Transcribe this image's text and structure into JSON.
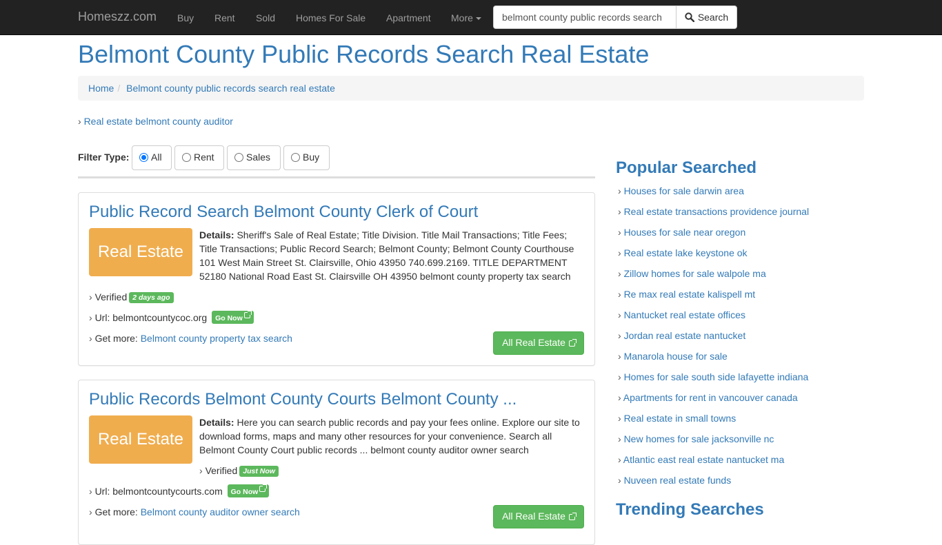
{
  "navbar": {
    "brand": "Homeszz.com",
    "items": [
      "Buy",
      "Rent",
      "Sold",
      "Homes For Sale",
      "Apartment",
      "More"
    ],
    "search_value": "belmont county public records search",
    "search_button": "Search"
  },
  "header": {
    "title": "Belmont County Public Records Search Real Estate",
    "breadcrumb": [
      "Home",
      "Belmont county public records search real estate"
    ],
    "related_link": "Real estate belmont county auditor"
  },
  "filter": {
    "label": "Filter Type:",
    "options": [
      "All",
      "Rent",
      "Sales",
      "Buy"
    ],
    "selected": "All"
  },
  "results": [
    {
      "title": "Public Record Search Belmont County Clerk of Court",
      "thumb": "Real Estate",
      "details_label": "Details:",
      "details": "Sheriff's Sale of Real Estate; Title Division. Title Mail Transactions; Title Fees; Title Transactions; Public Record Search; Belmont County; Belmont County Courthouse 101 West Main Street St. Clairsville, Ohio 43950 740.699.2169. TITLE DEPARTMENT 52180 National Road East St. Clairsville OH 43950 belmont county property tax search",
      "verified_label": "Verified",
      "verified_badge": "2 days ago",
      "url_label": "Url: belmontcountycoc.org",
      "go_now": "Go Now",
      "get_more_label": "Get more:",
      "get_more_link": "Belmont county property tax search",
      "button": "All Real Estate"
    },
    {
      "title": "Public Records Belmont County Courts Belmont County ...",
      "thumb": "Real Estate",
      "details_label": "Details:",
      "details": "Here you can search public records and pay your fees online. Explore our site to download forms, maps and many other resources for your convenience. Search all Belmont County Court public records ... belmont county auditor owner search",
      "verified_label": "Verified",
      "verified_badge": "Just Now",
      "url_label": "Url: belmontcountycourts.com",
      "go_now": "Go Now",
      "get_more_label": "Get more:",
      "get_more_link": "Belmont county auditor owner search",
      "button": "All Real Estate"
    }
  ],
  "sidebar": {
    "popular_title": "Popular Searched",
    "popular": [
      "Houses for sale darwin area",
      "Real estate transactions providence journal",
      "Houses for sale near oregon",
      "Real estate lake keystone ok",
      "Zillow homes for sale walpole ma",
      "Re max real estate kalispell mt",
      "Nantucket real estate offices",
      "Jordan real estate nantucket",
      "Manarola house for sale",
      "Homes for sale south side lafayette indiana",
      "Apartments for rent in vancouver canada",
      "Real estate in small towns",
      "New homes for sale jacksonville nc",
      "Atlantic east real estate nantucket ma",
      "Nuveen real estate funds"
    ],
    "trending_title": "Trending Searches"
  },
  "colors": {
    "navbar_bg": "#222222",
    "link": "#337ab7",
    "thumb_bg": "#f0ad4e",
    "success": "#5cb85c"
  }
}
